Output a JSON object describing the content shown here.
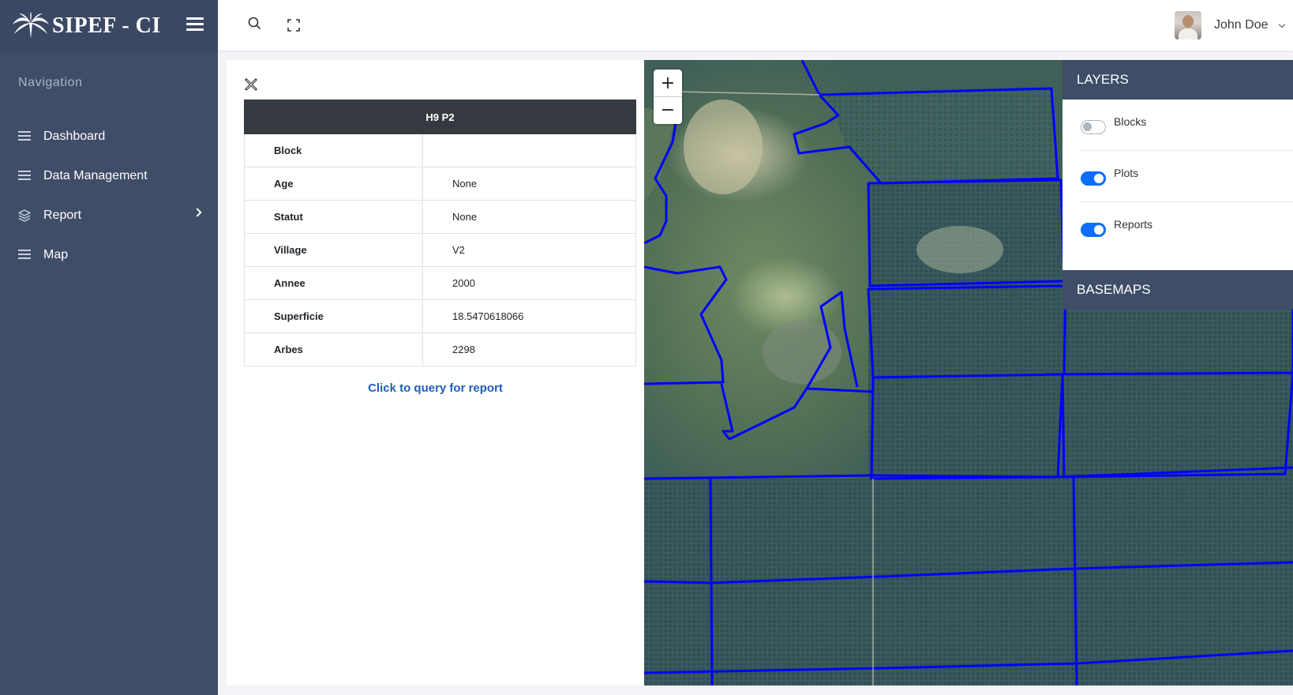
{
  "brand": {
    "name": "SIPEF - CI"
  },
  "sidebar": {
    "caption": "Navigation",
    "items": [
      {
        "label": "Dashboard",
        "icon": "list-icon"
      },
      {
        "label": "Data Management",
        "icon": "list-icon"
      },
      {
        "label": "Report",
        "icon": "layers-icon",
        "has_submenu": true
      },
      {
        "label": "Map",
        "icon": "list-icon"
      }
    ]
  },
  "header": {
    "icons": [
      "search-icon",
      "fullscreen-icon"
    ],
    "user_name": "John Doe"
  },
  "info_panel": {
    "title": "H9 P2",
    "rows": [
      {
        "key": "Block",
        "value": ""
      },
      {
        "key": "Age",
        "value": "None"
      },
      {
        "key": "Statut",
        "value": "None"
      },
      {
        "key": "Village",
        "value": "V2"
      },
      {
        "key": "Annee",
        "value": "2000"
      },
      {
        "key": "Superficie",
        "value": "18.5470618066"
      },
      {
        "key": "Arbes",
        "value": "2298"
      }
    ],
    "query_link": "Click to query for report"
  },
  "map": {
    "zoom_in": "+",
    "zoom_out": "−",
    "boundary_color": "#0000ff"
  },
  "layers": {
    "title": "LAYERS",
    "items": [
      {
        "label": "Blocks",
        "enabled": false
      },
      {
        "label": "Plots",
        "enabled": true
      },
      {
        "label": "Reports",
        "enabled": true
      }
    ],
    "basemaps_title": "BASEMAPS"
  },
  "colors": {
    "sidebar_bg": "#3f4d67",
    "table_header_bg": "#343a40",
    "link": "#1f5fb8",
    "toggle_on": "#0d6efd"
  }
}
